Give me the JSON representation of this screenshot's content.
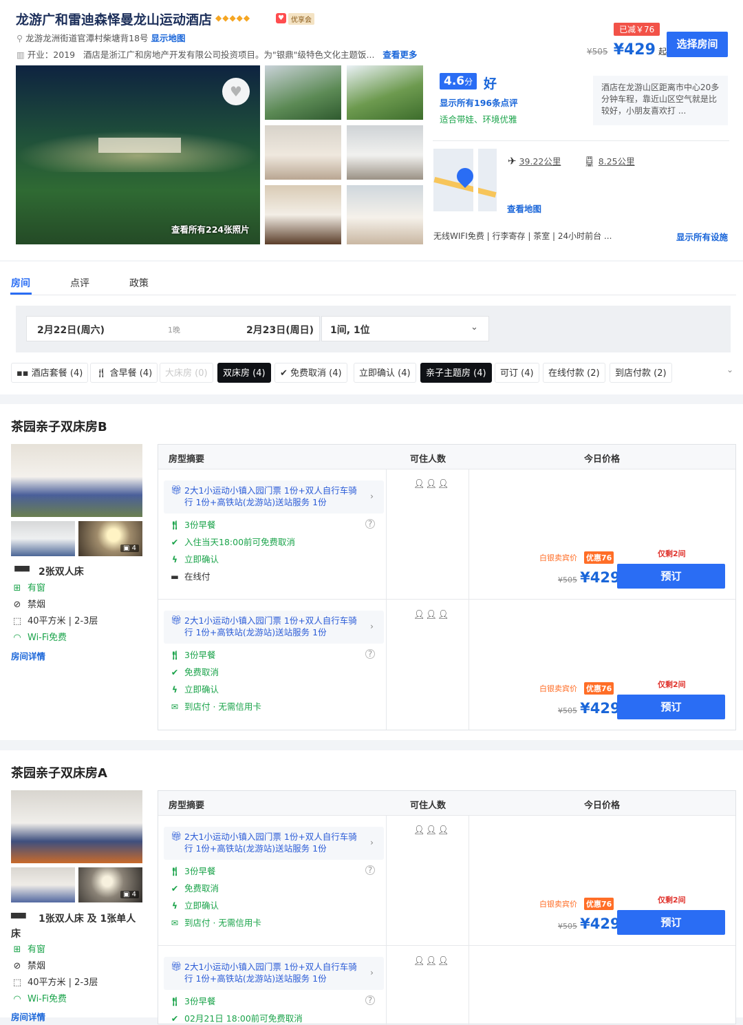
{
  "hotel": {
    "name": "龙游广和雷迪森怿曼龙山运动酒店",
    "badge": "优享会",
    "stars": "◆◆◆◆◆",
    "address": "龙游龙洲街道官潭村柴塘背18号",
    "address_link": "显示地图",
    "open_prefix": "开业：2019",
    "intro": "酒店是浙江广和房地产开发有限公司投资项目。为\"银鼎\"级特色文化主题饭...",
    "more_link": "查看更多"
  },
  "price_box": {
    "discount": "已减￥76",
    "old": "¥505",
    "now": "¥429",
    "suffix": "起",
    "button": "选择房间"
  },
  "gallery": {
    "all_photos": "查看所有224张照片"
  },
  "rating": {
    "score": "4.6",
    "unit": "分",
    "word": "好",
    "reviews": "显示所有196条点评",
    "tags": "适合带娃、环境优雅",
    "comment": "酒店在龙游山区距离市中心20多分钟车程，靠近山区空气就是比较好，小朋友喜欢打 ..."
  },
  "location": {
    "airport": "39.22公里",
    "station": "8.25公里",
    "map_link": "查看地图",
    "facilities": "无线WIFI免费 | 行李寄存 | 茶室 | 24小时前台 ...",
    "facilities_link": "显示所有设施"
  },
  "tabs": [
    {
      "label": "房间"
    },
    {
      "label": "点评"
    },
    {
      "label": "政策"
    }
  ],
  "search": {
    "checkin": "2月22日(周六)",
    "nights": "1晚",
    "checkout": "2月23日(周日)",
    "guests": "1间, 1位"
  },
  "filters": [
    {
      "label": "酒店套餐 (4)"
    },
    {
      "label": "含早餐 (4)"
    },
    {
      "label": "大床房 (0)"
    },
    {
      "label": "双床房 (4)"
    },
    {
      "label": "免费取消 (4)"
    },
    {
      "label": "立即确认 (4)"
    },
    {
      "label": "亲子主题房 (4)"
    },
    {
      "label": "可订 (4)"
    },
    {
      "label": "在线付款 (2)"
    },
    {
      "label": "到店付款 (2)"
    }
  ],
  "table_headers": {
    "summary": "房型摘要",
    "occupancy": "可住人数",
    "price": "今日价格"
  },
  "common": {
    "photo_count": "4",
    "package": "2大1小运动小镇入园门票 1份+双人自行车骑行 1份+高铁站(龙游站)送站服务 1份",
    "breakfast": "3份早餐",
    "confirm": "立即确认",
    "free_cancel": "免费取消",
    "pay_shop": "到店付 · 无需信用卡",
    "pay_online": "在线付",
    "remain": "仅剩2间",
    "member_price": "白银卖宾价",
    "coupon": "优惠76",
    "old_price": "¥505",
    "new_price": "¥429",
    "book": "预订",
    "window": "有窗",
    "nosmoke": "禁烟",
    "area": "40平方米 | 2-3层",
    "wifi": "Wi-Fi免费",
    "details": "房间详情"
  },
  "rooms": [
    {
      "name": "茶园亲子双床房B",
      "bed": "2张双人床",
      "rate1_cancel": "入住当天18:00前可免费取消"
    },
    {
      "name": "茶园亲子双床房A",
      "bed": "1张双人床 及 1张单人床",
      "rate2_cancel": "02月21日 18:00前可免费取消"
    }
  ]
}
